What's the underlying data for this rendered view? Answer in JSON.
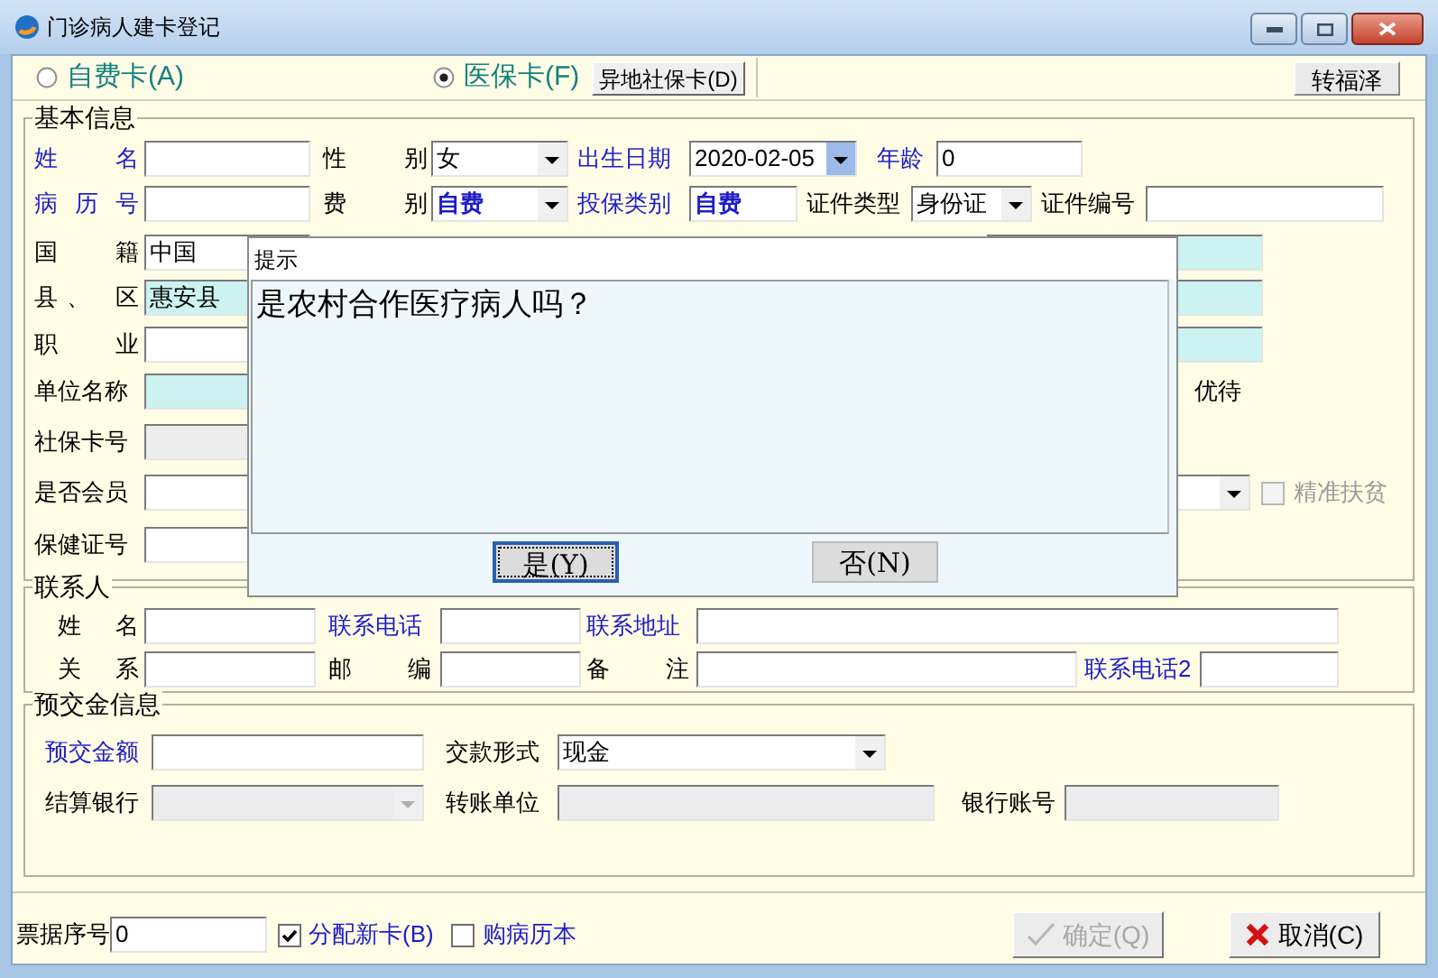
{
  "window": {
    "title": "门诊病人建卡登记"
  },
  "card_type": [
    {
      "label": "自费卡(A)",
      "selected": false
    },
    {
      "label": "医保卡(F)",
      "selected": true
    }
  ],
  "remote_card_button": "异地社保卡(D)",
  "transfer_button": "转福泽",
  "basic_info": {
    "title": "基本信息",
    "name": {
      "label": "姓 名",
      "highlight": true
    },
    "gender": {
      "label": "性 别",
      "highlight": false,
      "value": "女"
    },
    "birth_date": {
      "label": "出生日期",
      "highlight": true,
      "value": "2020-02-05"
    },
    "age": {
      "label": "年龄",
      "highlight": true,
      "value": "0"
    },
    "record_no": {
      "label": "病 历 号",
      "highlight": true
    },
    "fee_type": {
      "label": "费 别",
      "highlight": false,
      "value": "自费"
    },
    "insurance_type": {
      "label": "投保类别",
      "highlight": true,
      "value": "自费"
    },
    "id_type": {
      "label": "证件类型",
      "highlight": false,
      "value": "身份证"
    },
    "id_number": {
      "label": "证件编号",
      "highlight": false
    },
    "nationality": {
      "label": "国 籍",
      "highlight": false,
      "value": "中国"
    },
    "county": {
      "label": "县、 区",
      "highlight": false,
      "value": "惠安县"
    },
    "occupation": {
      "label": "职 业",
      "highlight": false
    },
    "employer": {
      "label": "单位名称",
      "highlight": false
    },
    "social_card": {
      "label": "社保卡号",
      "highlight": false,
      "disabled": true
    },
    "member": {
      "label": "是否会员",
      "highlight": false
    },
    "health_card": {
      "label": "保健证号",
      "highlight": false
    },
    "preferential_label": "优待",
    "poverty": {
      "label": "精准扶贫",
      "checked": false,
      "disabled": true
    }
  },
  "dialog": {
    "title": "提示",
    "message": "是农村合作医疗病人吗？",
    "buttons": [
      {
        "label": "是(Y)",
        "focused": true
      },
      {
        "label": "否(N)",
        "focused": false
      }
    ]
  },
  "contact": {
    "title": "联系人",
    "name": {
      "label": "姓 名",
      "highlight": false
    },
    "phone": {
      "label": "联系电话",
      "highlight": true
    },
    "address": {
      "label": "联系地址",
      "highlight": true
    },
    "relation": {
      "label": "关 系",
      "highlight": false
    },
    "postcode": {
      "label": "邮 编",
      "highlight": false
    },
    "remark": {
      "label": "备 注",
      "highlight": false
    },
    "phone2": {
      "label": "联系电话2",
      "highlight": true
    }
  },
  "deposit": {
    "title": "预交金信息",
    "amount": {
      "label": "预交金额",
      "highlight": true
    },
    "payment_method": {
      "label": "交款形式",
      "highlight": false,
      "value": "现金"
    },
    "bank": {
      "label": "结算银行",
      "highlight": false,
      "disabled": true
    },
    "transfer_unit": {
      "label": "转账单位",
      "highlight": false,
      "disabled": true
    },
    "account": {
      "label": "银行账号",
      "highlight": false,
      "disabled": true
    }
  },
  "footer": {
    "receipt_no": {
      "label": "票据序号",
      "value": "0"
    },
    "options": [
      {
        "label": "分配新卡(B)",
        "checked": true
      },
      {
        "label": "购病历本",
        "checked": false
      }
    ],
    "buttons": [
      {
        "kind": "confirm",
        "label": "确定(Q)",
        "disabled": true
      },
      {
        "kind": "cancel",
        "label": "取消(C)",
        "disabled": false
      }
    ]
  }
}
